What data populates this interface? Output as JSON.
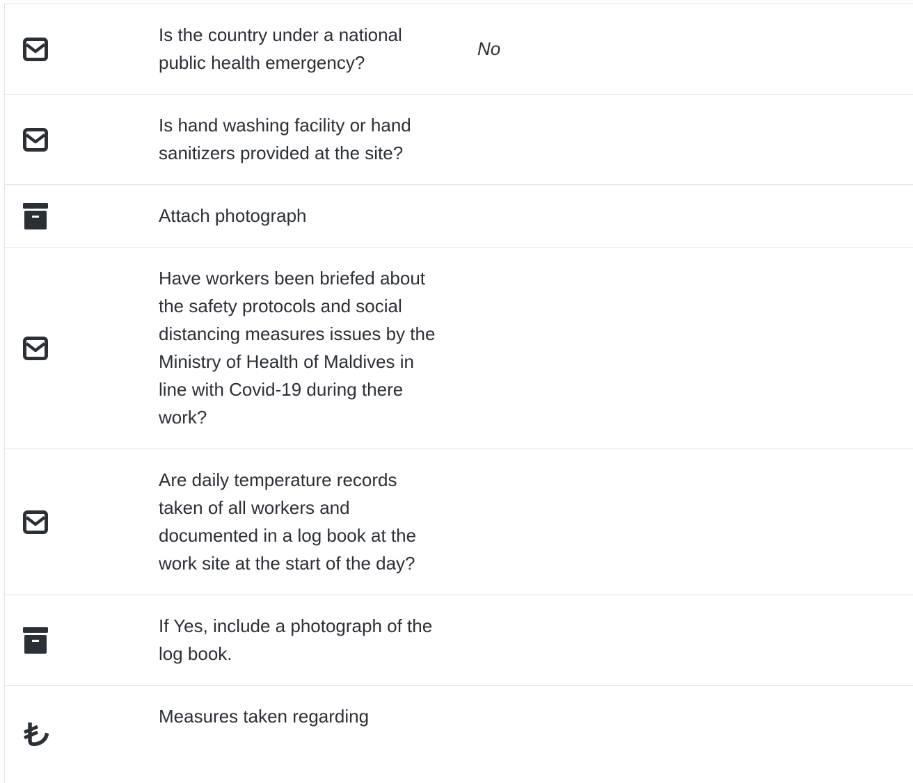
{
  "rows": [
    {
      "icon": "envelope-icon",
      "question": "Is the country under a national public health emergency?",
      "answer": "No"
    },
    {
      "icon": "envelope-icon",
      "question": "Is hand washing facility or hand sanitizers provided at the site?",
      "answer": ""
    },
    {
      "icon": "archive-icon",
      "question": "Attach photograph",
      "answer": ""
    },
    {
      "icon": "envelope-icon",
      "question": "Have workers been briefed about the safety protocols and social distancing measures issues by the Ministry of Health of Maldives in line with Covid-19 during there work?",
      "answer": ""
    },
    {
      "icon": "envelope-icon",
      "question": "Are daily temperature records taken of all workers and documented in a log book at the work site at the start of the day?",
      "answer": ""
    },
    {
      "icon": "archive-icon",
      "question": "If Yes, include a photograph of the log book.",
      "answer": ""
    },
    {
      "icon": "lira-icon",
      "question": "Measures taken regarding",
      "answer": ""
    }
  ]
}
